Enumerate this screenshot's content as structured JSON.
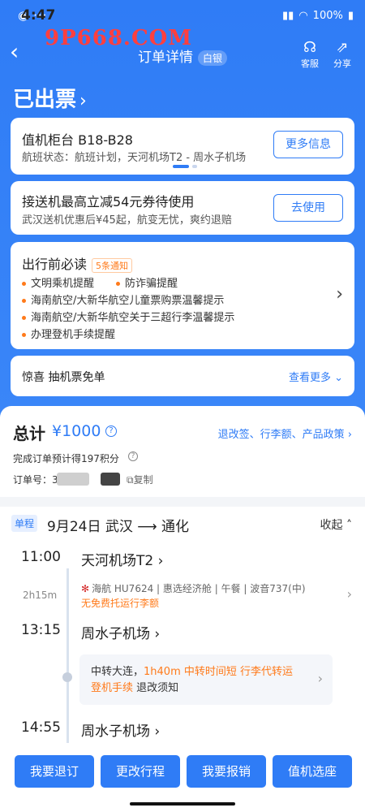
{
  "statusbar": {
    "time": "4:47",
    "battery": "100%"
  },
  "watermark": "9P668.COM",
  "nav": {
    "title": "订单详情",
    "member_badge": "白银",
    "service_label": "客服",
    "share_label": "分享"
  },
  "status": {
    "issued": "已出票"
  },
  "checkin": {
    "title": "值机柜台 B18-B28",
    "flight_status": "航班状态：航班计划，天河机场T2 - 周水子机场",
    "more_button": "更多信息"
  },
  "coupon": {
    "title": "接送机最高立减54元券待使用",
    "subtitle": "武汉送机优惠后¥45起，航变无忧，爽约退赔",
    "use_button": "去使用"
  },
  "notice": {
    "title": "出行前必读",
    "count_tag": "5条通知",
    "items": [
      "文明乘机提醒",
      "防诈骗提醒",
      "海南航空/大新华航空儿童票购票温馨提示",
      "海南航空/大新华航空关于三超行李温馨提示",
      "办理登机手续提醒"
    ]
  },
  "promo": {
    "label": "惊喜 抽机票免单",
    "see_more": "查看更多"
  },
  "summary": {
    "total_label": "总计",
    "total_value": "¥1000",
    "policy_link": "退改签、行李额、产品政策",
    "points": "完成订单预计得197积分",
    "order_no_label": "订单号：3",
    "copy_label": "复制"
  },
  "itinerary": {
    "type_tag": "单程",
    "route": "9月24日  武汉 ⟶ 通化",
    "collapse": "收起",
    "segments": {
      "dep_time": "11:00",
      "dep_airport": "天河机场T2",
      "duration": "2h15m",
      "flight": "海航 HU7624 | 惠选经济舱 | 午餐 | 波音737(中)",
      "baggage": "无免费托运行李额",
      "arr_time": "13:15",
      "arr_airport": "周水子机场",
      "next_time": "14:55",
      "next_airport": "周水子机场"
    },
    "transfer": {
      "prefix": "中转大连，",
      "highlight": "1h40m  中转时间短  行李代转运",
      "line2_highlight": "登机手续",
      "line2_rest": "  退改须知"
    }
  },
  "actions": {
    "refund": "我要退订",
    "change": "更改行程",
    "reimburse": "我要报销",
    "checkin": "值机选座"
  }
}
